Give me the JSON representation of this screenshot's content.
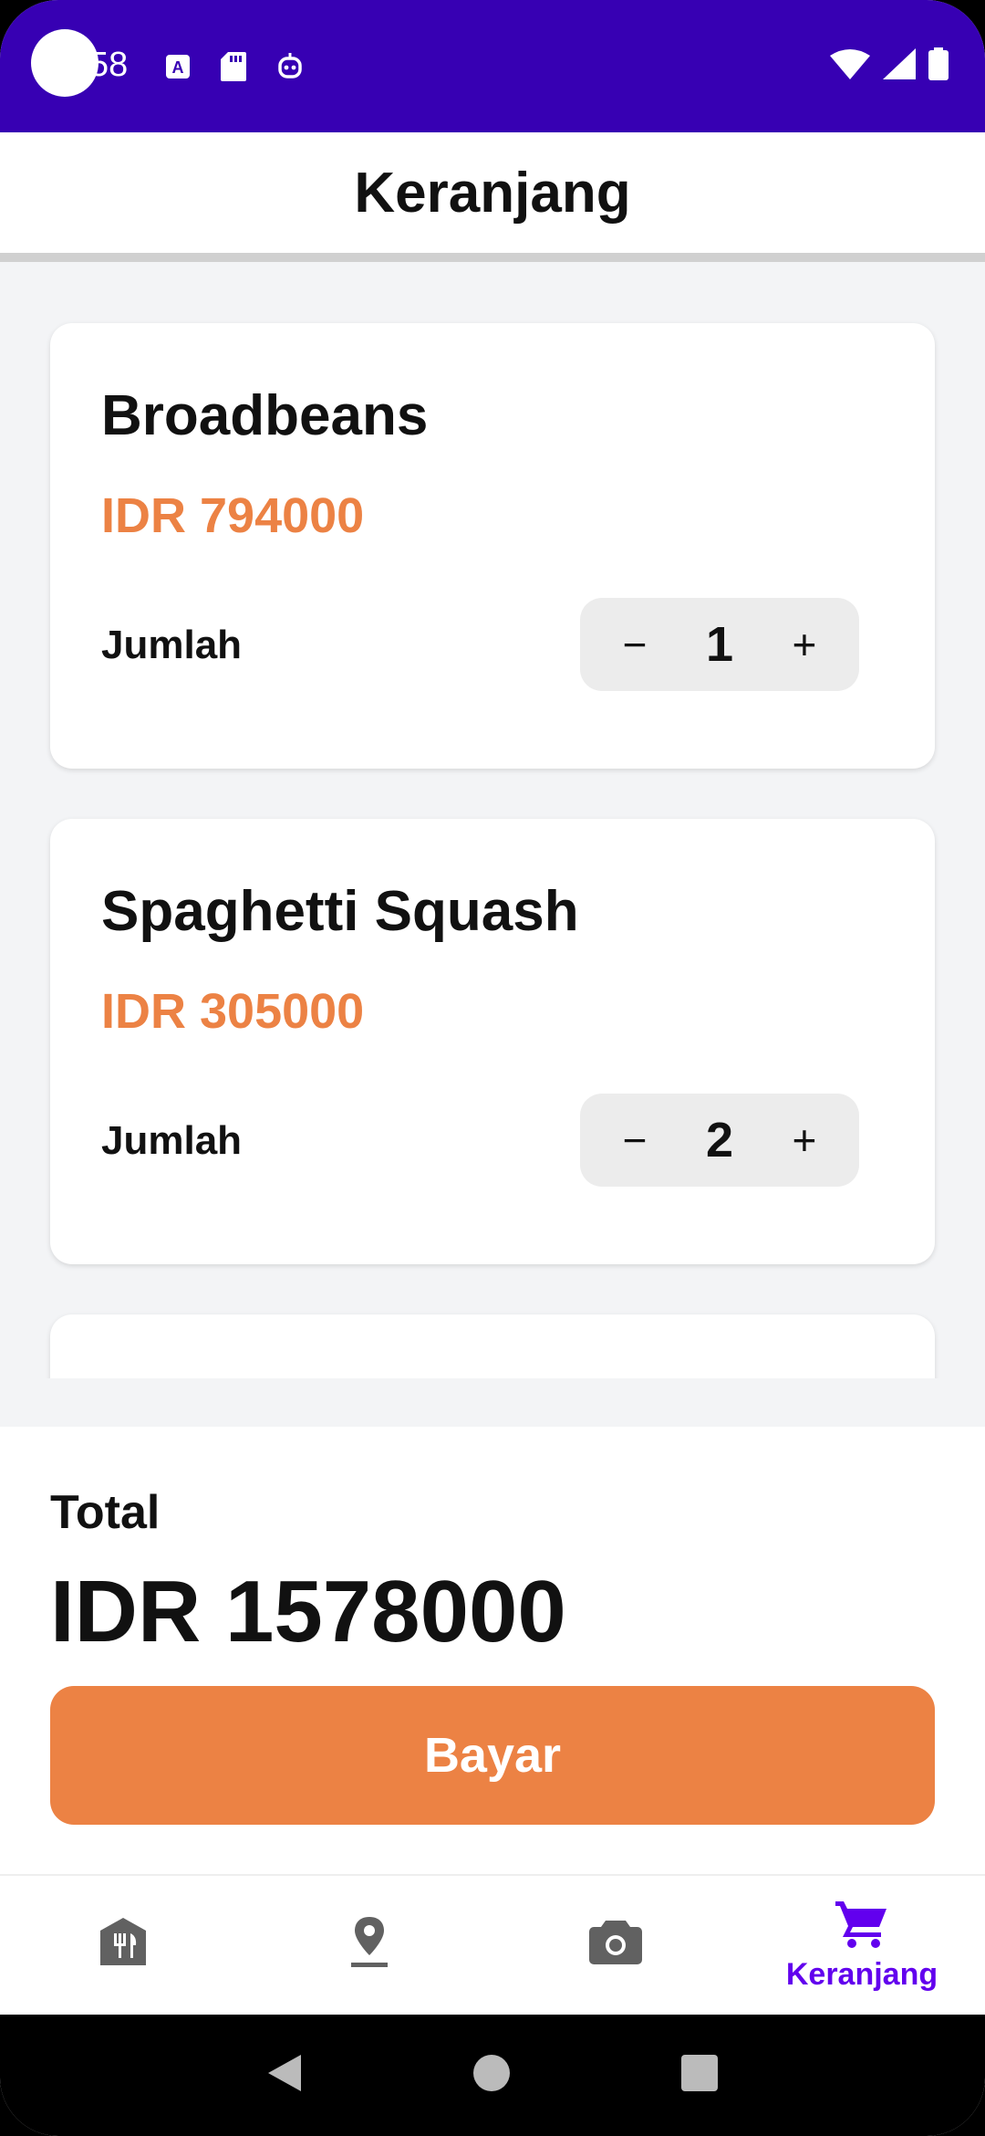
{
  "status_bar": {
    "time": "58",
    "icons": [
      "keyboard-a-icon",
      "sd-card-icon",
      "robot-icon",
      "wifi-icon",
      "signal-icon",
      "battery-icon"
    ]
  },
  "header": {
    "title": "Keranjang"
  },
  "cart": {
    "items": [
      {
        "name": "Broadbeans",
        "price": "IDR 794000",
        "qty_label": "Jumlah",
        "qty": "1",
        "minus": "−",
        "plus": "+"
      },
      {
        "name": "Spaghetti Squash",
        "price": "IDR 305000",
        "qty_label": "Jumlah",
        "qty": "2",
        "minus": "−",
        "plus": "+"
      }
    ]
  },
  "summary": {
    "total_label": "Total",
    "total_value": "IDR 1578000",
    "pay_label": "Bayar"
  },
  "bottom_nav": {
    "items": [
      {
        "icon": "restaurant-icon",
        "label": ""
      },
      {
        "icon": "location-pin-icon",
        "label": ""
      },
      {
        "icon": "camera-icon",
        "label": ""
      },
      {
        "icon": "cart-icon",
        "label": "Keranjang",
        "active": true
      }
    ]
  },
  "colors": {
    "status_bar": "#3700b3",
    "accent": "#ec8244",
    "nav_active": "#6200ee",
    "nav_inactive": "#616161"
  }
}
